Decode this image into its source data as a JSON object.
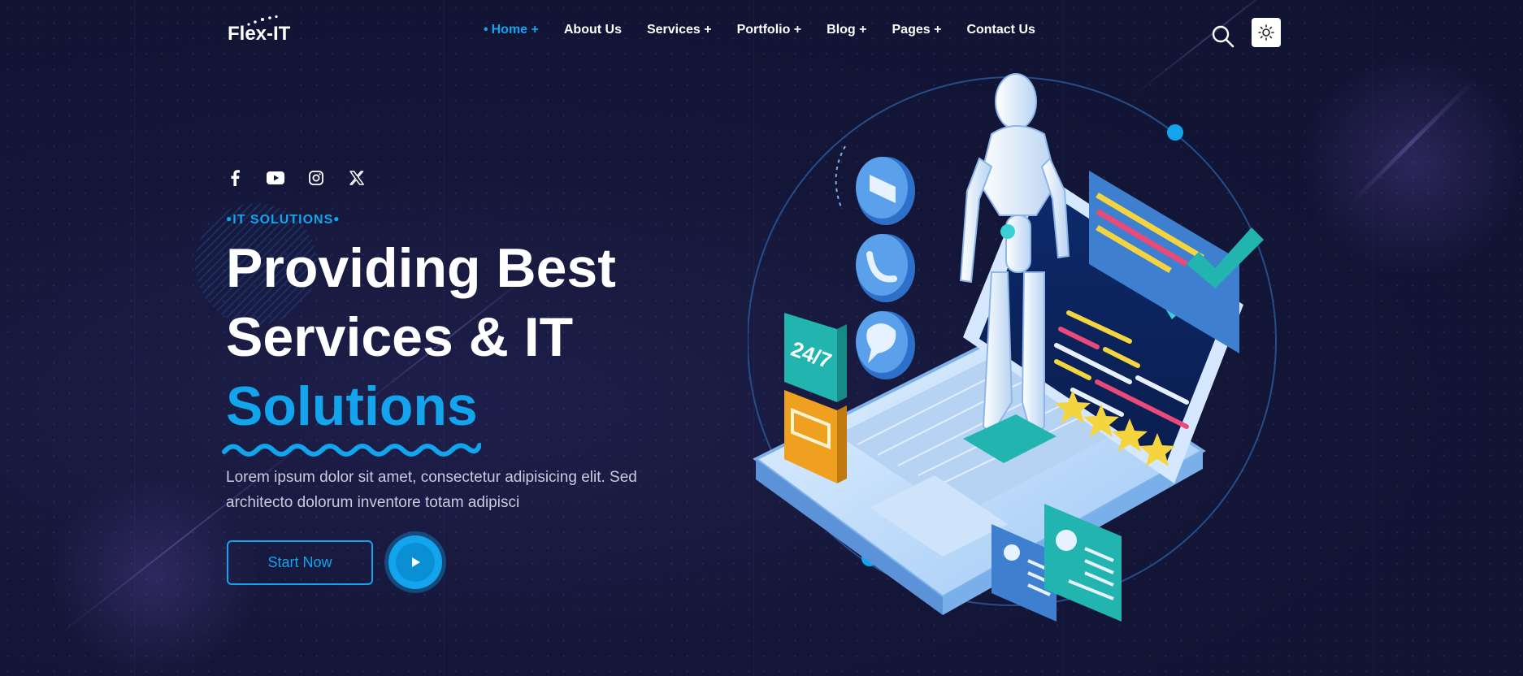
{
  "brand": {
    "name": "Flex-IT",
    "accent": "#12a4ec",
    "background": "#141638"
  },
  "nav": {
    "items": [
      {
        "label": "Home +",
        "active": true
      },
      {
        "label": "About Us",
        "active": false
      },
      {
        "label": "Services +",
        "active": false
      },
      {
        "label": "Portfolio +",
        "active": false
      },
      {
        "label": "Blog +",
        "active": false
      },
      {
        "label": "Pages +",
        "active": false
      },
      {
        "label": "Contact Us",
        "active": false
      }
    ],
    "search_icon": "search-icon",
    "theme_icon": "sun-icon"
  },
  "social": {
    "icons": [
      "facebook-icon",
      "youtube-icon",
      "instagram-icon",
      "x-icon"
    ]
  },
  "hero": {
    "tagline": "IT SOLUTIONS",
    "headline_line1": "Providing Best",
    "headline_line2": "Services & IT",
    "headline_accent": "Solutions",
    "description": "Lorem ipsum dolor sit amet, consectetur adipisicing elit. Sed architecto dolorum inventore totam adipisci",
    "cta_label": "Start Now",
    "play_icon": "play-icon"
  },
  "illustration": {
    "badge_text": "24/7",
    "subject": "robot-on-laptop-illustration"
  }
}
